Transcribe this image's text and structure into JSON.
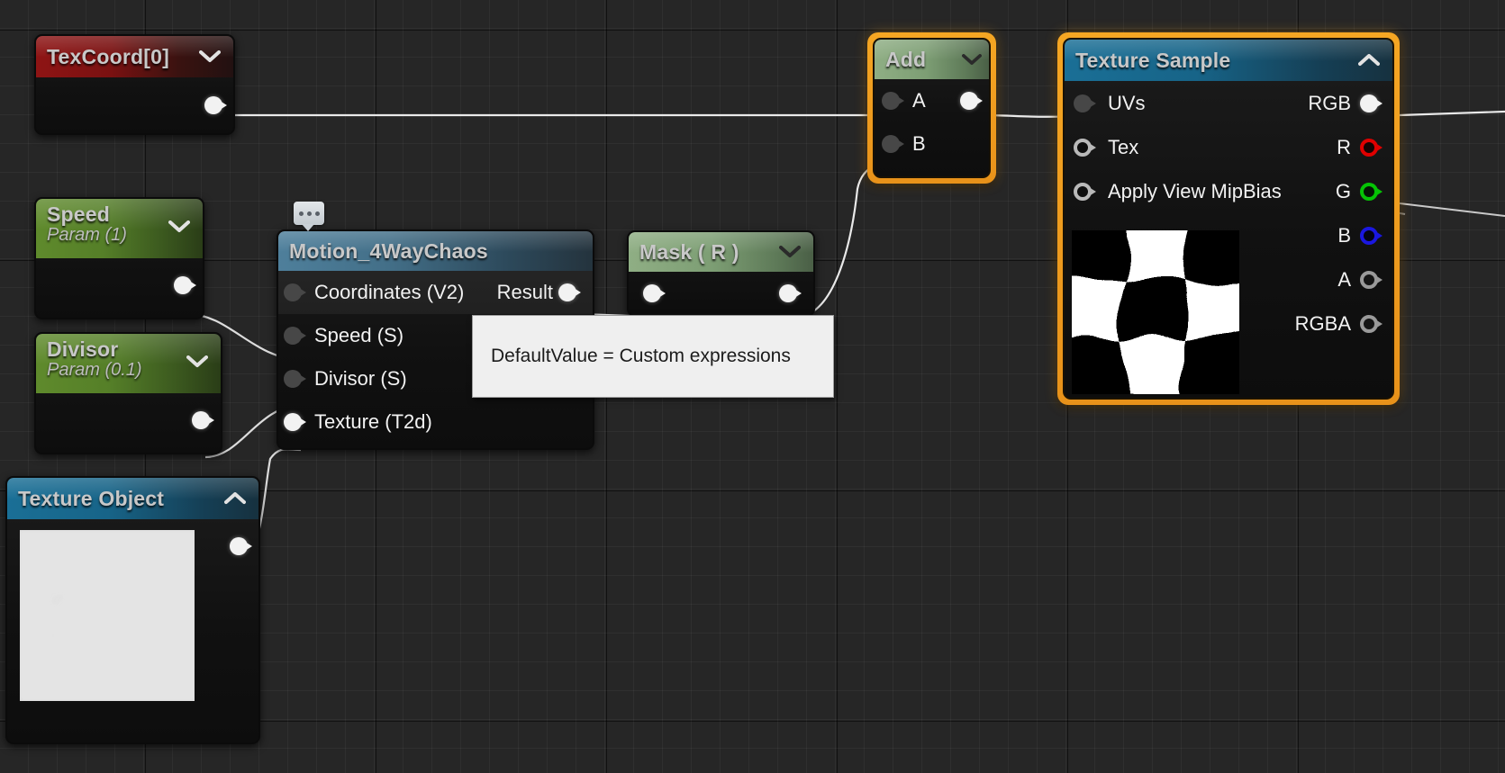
{
  "app": {
    "title": "Material Editor Graph",
    "background_color": "#262626",
    "selection_color": "#f5a623"
  },
  "nodes": [
    {
      "id": "texcoord",
      "title": "TexCoord[0]",
      "subtitle": "",
      "header_color": "#8e1414",
      "collapse_icon": "chevron-down-icon",
      "selected": false,
      "inputs": [],
      "outputs": [
        {
          "label": "",
          "pin": "filled"
        }
      ]
    },
    {
      "id": "speed",
      "title": "Speed",
      "subtitle": "Param (1)",
      "header_color": "#5f8a2c",
      "collapse_icon": "chevron-down-icon",
      "selected": false,
      "inputs": [],
      "outputs": [
        {
          "label": "",
          "pin": "filled"
        }
      ]
    },
    {
      "id": "divisor",
      "title": "Divisor",
      "subtitle": "Param (0.1)",
      "header_color": "#5f8a2c",
      "collapse_icon": "chevron-down-icon",
      "selected": false,
      "inputs": [],
      "outputs": [
        {
          "label": "",
          "pin": "filled"
        }
      ]
    },
    {
      "id": "texture_object",
      "title": "Texture Object",
      "subtitle": "",
      "header_color": "#1a6f96",
      "collapse_icon": "chevron-up-icon",
      "selected": false,
      "preview": "noise-thumbnail",
      "inputs": [],
      "outputs": [
        {
          "label": "",
          "pin": "filled"
        }
      ]
    },
    {
      "id": "motion_4waychaos",
      "title": "Motion_4WayChaos",
      "subtitle": "",
      "header_color": "#4e7f9b",
      "collapse_icon": "none",
      "selected": false,
      "comment_bubble": "comment-bubble-icon",
      "inputs": [
        {
          "label": "Coordinates (V2)",
          "pin": "dim"
        },
        {
          "label": "Speed (S)",
          "pin": "dim"
        },
        {
          "label": "Divisor (S)",
          "pin": "dim"
        },
        {
          "label": "Texture (T2d)",
          "pin": "filled"
        }
      ],
      "outputs": [
        {
          "label": "Result",
          "pin": "filled"
        }
      ]
    },
    {
      "id": "mask_r",
      "title": "Mask ( R )",
      "subtitle": "",
      "header_color": "#8fae84",
      "collapse_icon": "chevron-down-icon",
      "selected": false,
      "inputs": [
        {
          "label": "",
          "pin": "filled"
        }
      ],
      "outputs": [
        {
          "label": "",
          "pin": "filled"
        }
      ]
    },
    {
      "id": "add",
      "title": "Add",
      "subtitle": "",
      "header_color": "#8fae84",
      "collapse_icon": "chevron-down-icon",
      "selected": true,
      "inputs": [
        {
          "label": "A",
          "pin": "dim"
        },
        {
          "label": "B",
          "pin": "dim"
        }
      ],
      "outputs": [
        {
          "label": "",
          "pin": "filled"
        }
      ]
    },
    {
      "id": "texture_sample",
      "title": "Texture Sample",
      "subtitle": "",
      "header_color": "#1a6f96",
      "collapse_icon": "chevron-up-icon",
      "selected": true,
      "preview": "checker-thumbnail",
      "inputs": [
        {
          "label": "UVs",
          "pin": "dim"
        },
        {
          "label": "Tex",
          "pin": "hollow"
        },
        {
          "label": "Apply View MipBias",
          "pin": "hollow"
        }
      ],
      "outputs": [
        {
          "label": "RGB",
          "pin": "filled"
        },
        {
          "label": "R",
          "pin": "red"
        },
        {
          "label": "G",
          "pin": "green"
        },
        {
          "label": "B",
          "pin": "blue"
        },
        {
          "label": "A",
          "pin": "gray"
        },
        {
          "label": "RGBA",
          "pin": "gray"
        }
      ]
    }
  ],
  "tooltip": {
    "text": "DefaultValue = Custom expressions"
  }
}
